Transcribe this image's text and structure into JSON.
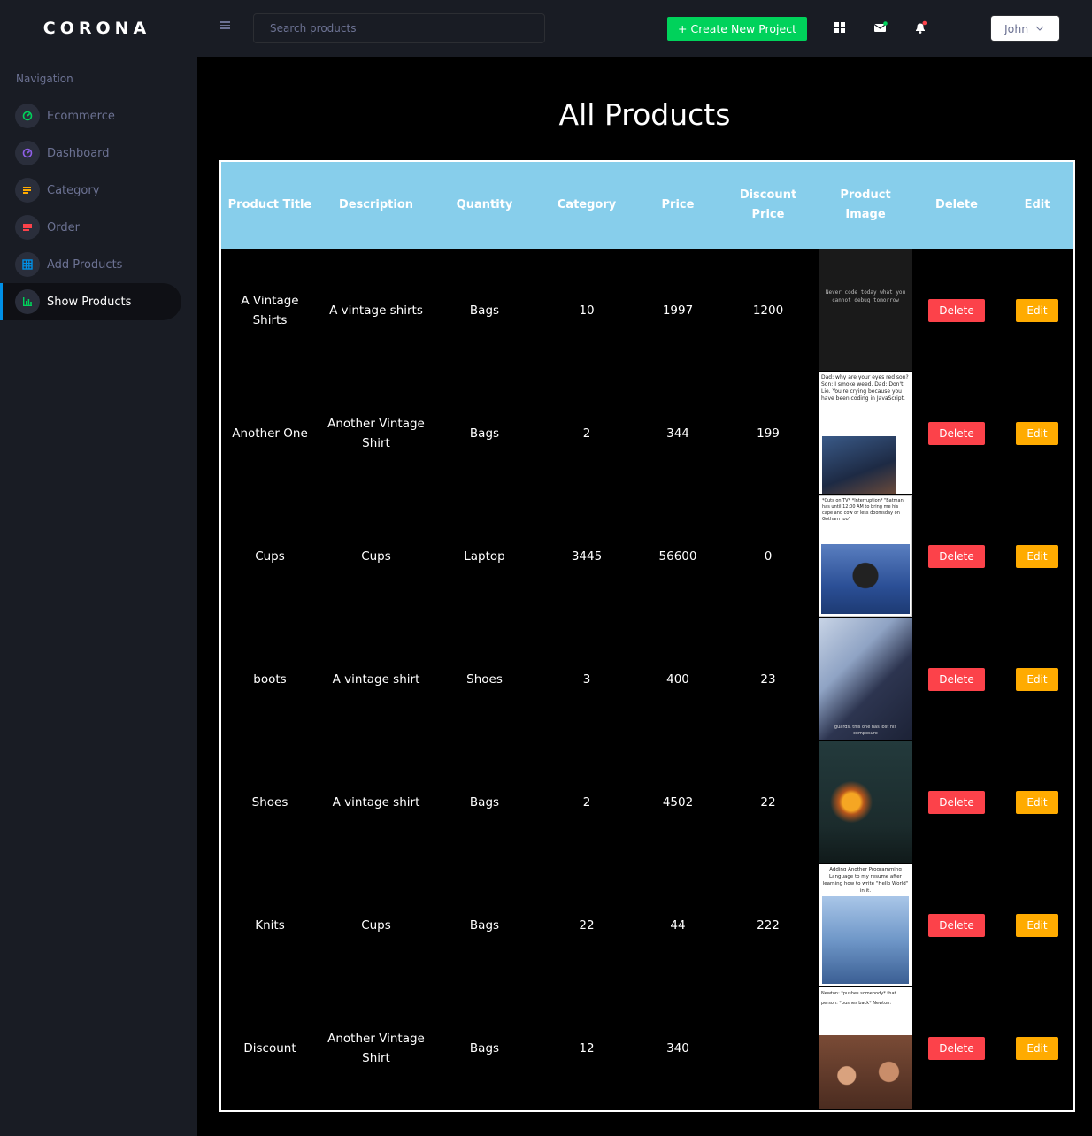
{
  "brand": "CORONA",
  "nav": {
    "title": "Navigation",
    "items": [
      {
        "label": "Ecommerce",
        "icon": "speedometer-icon",
        "color": "#00d25b"
      },
      {
        "label": "Dashboard",
        "icon": "speedometer-icon",
        "color": "#8f5fe8"
      },
      {
        "label": "Category",
        "icon": "layers-icon",
        "color": "#ffab00"
      },
      {
        "label": "Order",
        "icon": "list-icon",
        "color": "#fc424a"
      },
      {
        "label": "Add Products",
        "icon": "table-icon",
        "color": "#0090e7"
      },
      {
        "label": "Show Products",
        "icon": "bar-chart-icon",
        "color": "#00d25b",
        "active": true
      }
    ]
  },
  "topbar": {
    "search_placeholder": "Search products",
    "create_label": "+ Create New Project",
    "user_name": "John"
  },
  "page": {
    "title": "All Products"
  },
  "table": {
    "headers": [
      "Product Title",
      "Description",
      "Quantity",
      "Category",
      "Price",
      "Discount Price",
      "Product Image",
      "Delete",
      "Edit"
    ],
    "delete_label": "Delete",
    "edit_label": "Edit",
    "rows": [
      {
        "title": "A Vintage Shirts",
        "description": "A vintage shirts",
        "quantity": "Bags",
        "category": "10",
        "price": "1997",
        "discount": "1200",
        "image_text": "Never code today what you cannot debug tomorrow"
      },
      {
        "title": "Another One",
        "description": "Another Vintage Shirt",
        "quantity": "Bags",
        "category": "2",
        "price": "344",
        "discount": "199",
        "image_text": "Dad: why are your eyes red son? Son: I smoke weed. Dad: Don't Lie. You're crying because you have been coding in JavaScript."
      },
      {
        "title": "Cups",
        "description": "Cups",
        "quantity": "Laptop",
        "category": "3445",
        "price": "56600",
        "discount": "0",
        "image_text": "*Cuts on TV* *Interruption* \"Batman has until 12:00 AM to bring me his cape and cow or less doomsday on Gotham too\""
      },
      {
        "title": "boots",
        "description": "A vintage shirt",
        "quantity": "Shoes",
        "category": "3",
        "price": "400",
        "discount": "23",
        "image_text": "guards, this one has lost his composure"
      },
      {
        "title": "Shoes",
        "description": "A vintage shirt",
        "quantity": "Bags",
        "category": "2",
        "price": "4502",
        "discount": "22",
        "image_text": ""
      },
      {
        "title": "Knits",
        "description": "Cups",
        "quantity": "Bags",
        "category": "22",
        "price": "44",
        "discount": "222",
        "image_text": "Adding Another Programming Language to my resume after learning how to write \"Hello World\" in it."
      },
      {
        "title": "Discount",
        "description": "Another Vintage Shirt",
        "quantity": "Bags",
        "category": "12",
        "price": "340",
        "discount": "",
        "image_text": "Newton: *pushes somebody* that person: *pushes back* Newton:"
      }
    ]
  }
}
